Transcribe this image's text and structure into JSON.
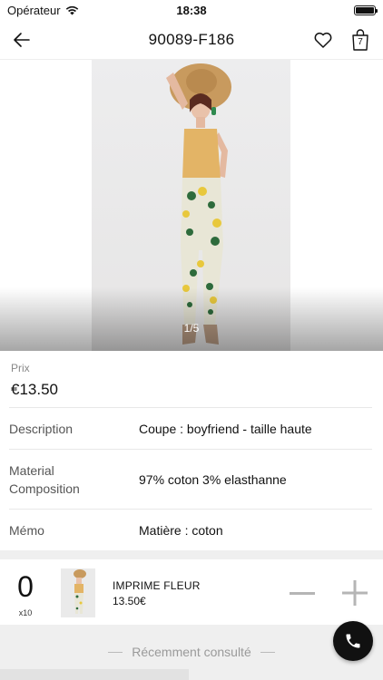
{
  "status_bar": {
    "carrier": "Opérateur",
    "time": "18:38"
  },
  "nav": {
    "title": "90089-F186",
    "cart_count": "7"
  },
  "gallery": {
    "counter": "1/5"
  },
  "product": {
    "price_label": "Prix",
    "price": "€13.50",
    "details": [
      {
        "label": "Description",
        "value": "Coupe : boyfriend - taille haute"
      },
      {
        "label": "Material\nComposition",
        "value": "97% coton 3% elasthanne"
      },
      {
        "label": "Mémo",
        "value": "Matière : coton"
      }
    ]
  },
  "cart_item": {
    "quantity": "0",
    "multiplier": "x10",
    "name": "IMPRIME FLEUR",
    "price": "13.50€"
  },
  "recent": {
    "title": "Récemment consulté"
  },
  "colors": {
    "accent": "#111111",
    "separator": "#efefef"
  },
  "icons": [
    "wifi-icon",
    "battery-icon",
    "back-arrow-icon",
    "heart-icon",
    "shopping-bag-icon",
    "minus-icon",
    "plus-icon",
    "phone-icon"
  ]
}
